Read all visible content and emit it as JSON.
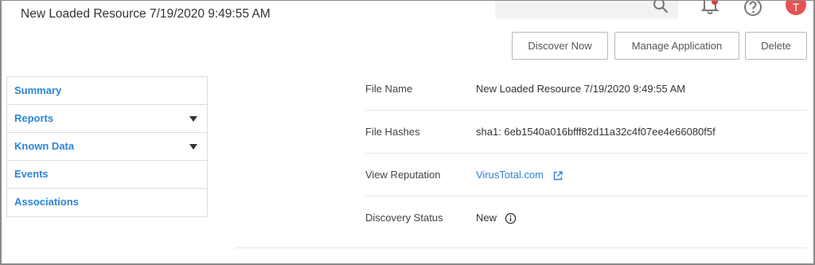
{
  "header": {
    "title": "New Loaded Resource 7/19/2020 9:49:55 AM",
    "search_placeholder": "",
    "avatar_initial": "T",
    "accent_color": "#2b84d8",
    "avatar_color": "#e55353"
  },
  "toolbar": {
    "discover_label": "Discover Now",
    "manage_label": "Manage Application",
    "delete_label": "Delete"
  },
  "sidebar": {
    "items": [
      {
        "label": "Summary",
        "has_dropdown": false
      },
      {
        "label": "Reports",
        "has_dropdown": true
      },
      {
        "label": "Known Data",
        "has_dropdown": true
      },
      {
        "label": "Events",
        "has_dropdown": false
      },
      {
        "label": "Associations",
        "has_dropdown": false
      }
    ]
  },
  "details": {
    "file_name": {
      "label": "File Name",
      "value": "New Loaded Resource 7/19/2020 9:49:55 AM"
    },
    "file_hashes": {
      "label": "File Hashes",
      "value": "sha1: 6eb1540a016bfff82d11a32c4f07ee4e66080f5f"
    },
    "view_reputation": {
      "label": "View Reputation",
      "value": "VirusTotal.com"
    },
    "discovery_status": {
      "label": "Discovery Status",
      "value": "New"
    }
  }
}
